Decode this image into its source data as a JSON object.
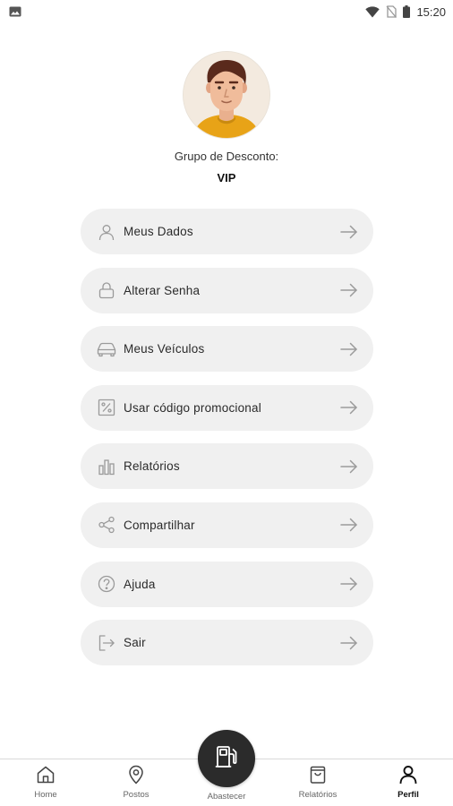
{
  "status_bar": {
    "time": "15:20",
    "icons": [
      "image-notification-icon",
      "wifi-icon",
      "no-sim-icon",
      "battery-icon"
    ]
  },
  "profile": {
    "group_label": "Grupo de Desconto:",
    "group_value": "VIP"
  },
  "menu": {
    "items": [
      {
        "label": "Meus Dados",
        "icon": "user-icon"
      },
      {
        "label": "Alterar Senha",
        "icon": "lock-icon"
      },
      {
        "label": "Meus Veículos",
        "icon": "car-icon"
      },
      {
        "label": "Usar código promocional",
        "icon": "percent-icon"
      },
      {
        "label": "Relatórios",
        "icon": "bar-chart-icon"
      },
      {
        "label": "Compartilhar",
        "icon": "share-icon"
      },
      {
        "label": "Ajuda",
        "icon": "help-icon"
      },
      {
        "label": "Sair",
        "icon": "logout-icon"
      }
    ]
  },
  "bottom_nav": {
    "items": [
      {
        "label": "Home",
        "icon": "home-icon"
      },
      {
        "label": "Postos",
        "icon": "location-pin-icon"
      },
      {
        "label": "Abastecer",
        "icon": "fuel-pump-icon"
      },
      {
        "label": "Relatórios",
        "icon": "shopping-bag-icon"
      },
      {
        "label": "Perfil",
        "icon": "profile-icon",
        "active": true
      }
    ]
  },
  "colors": {
    "menu_bg": "#f0f0f0",
    "fab_bg": "#2b2b2b",
    "avatar_shirt": "#e8a317",
    "avatar_hair": "#5a2a1c"
  }
}
